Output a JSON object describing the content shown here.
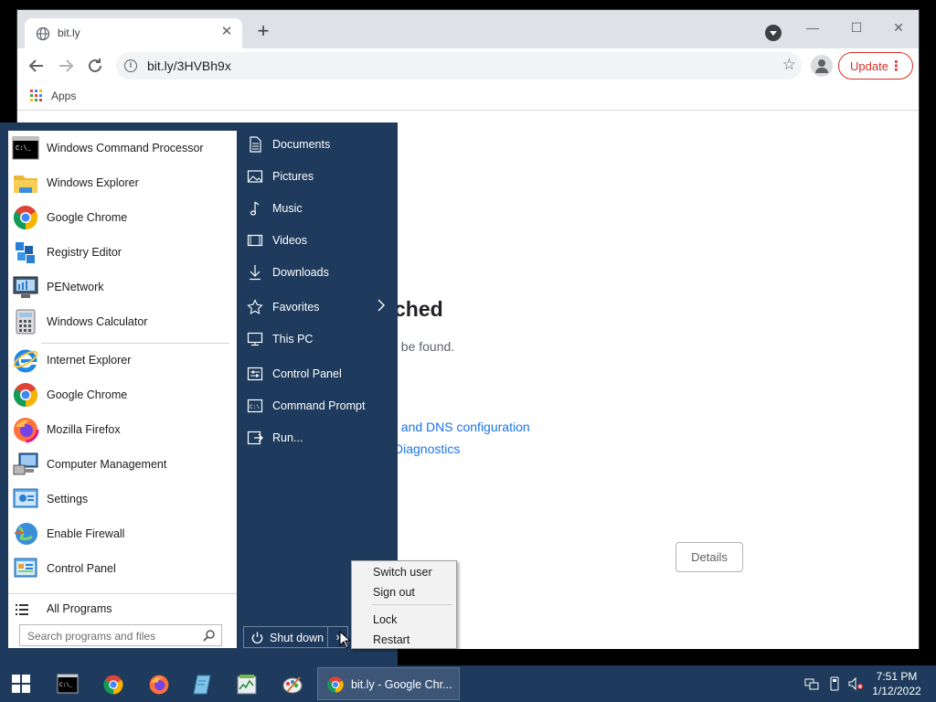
{
  "browser": {
    "tab_title": "bit.ly",
    "tab_close": "✕",
    "new_tab": "+",
    "url": "bit.ly/3HVBh9x",
    "update_label": "Update",
    "bookmarks_apps": "Apps",
    "window_controls": {
      "minimize": "—",
      "maximize": "☐",
      "close": "✕"
    }
  },
  "page": {
    "title_partial": "ched",
    "subtitle_partial": "t be found.",
    "link1_partial": ", and DNS configuration",
    "link2_partial": "Diagnostics",
    "details_button": "Details"
  },
  "start_menu": {
    "programs": [
      {
        "label": "Windows Command Processor",
        "icon": "cmd-icon"
      },
      {
        "label": "Windows Explorer",
        "icon": "folder-icon"
      },
      {
        "label": "Google Chrome",
        "icon": "chrome-icon"
      },
      {
        "label": "Registry Editor",
        "icon": "registry-icon"
      },
      {
        "label": "PENetwork",
        "icon": "network-icon"
      },
      {
        "label": "Windows Calculator",
        "icon": "calculator-icon"
      },
      {
        "label": "Internet Explorer",
        "icon": "ie-icon"
      },
      {
        "label": "Google Chrome",
        "icon": "chrome-icon"
      },
      {
        "label": "Mozilla Firefox",
        "icon": "firefox-icon"
      },
      {
        "label": "Computer Management",
        "icon": "computer-management-icon"
      },
      {
        "label": "Settings",
        "icon": "settings-icon"
      },
      {
        "label": "Enable Firewall",
        "icon": "firewall-icon"
      },
      {
        "label": "Control Panel",
        "icon": "control-panel-icon"
      }
    ],
    "all_programs": "All Programs",
    "search_placeholder": "Search programs and files",
    "places": [
      {
        "label": "Documents",
        "icon": "document-icon"
      },
      {
        "label": "Pictures",
        "icon": "picture-icon"
      },
      {
        "label": "Music",
        "icon": "music-icon"
      },
      {
        "label": "Videos",
        "icon": "video-icon"
      },
      {
        "label": "Downloads",
        "icon": "download-icon"
      },
      {
        "label": "Favorites",
        "icon": "star-icon"
      },
      {
        "label": "This PC",
        "icon": "monitor-icon"
      },
      {
        "label": "Control Panel",
        "icon": "control-panel-icon"
      },
      {
        "label": "Command Prompt",
        "icon": "terminal-icon"
      },
      {
        "label": "Run...",
        "icon": "run-icon"
      }
    ],
    "shutdown_label": "Shut down",
    "shutdown_arrow": "›"
  },
  "power_menu": {
    "items": [
      "Switch user",
      "Sign out",
      "Lock",
      "Restart"
    ]
  },
  "taskbar": {
    "active_window_label": "bit.ly - Google Chr...",
    "time": "7:51 PM",
    "date": "1/12/2022"
  },
  "colors": {
    "start_menu_bg": "#1e3a5c",
    "update_red": "#d93025",
    "link_blue": "#1a73e8"
  }
}
